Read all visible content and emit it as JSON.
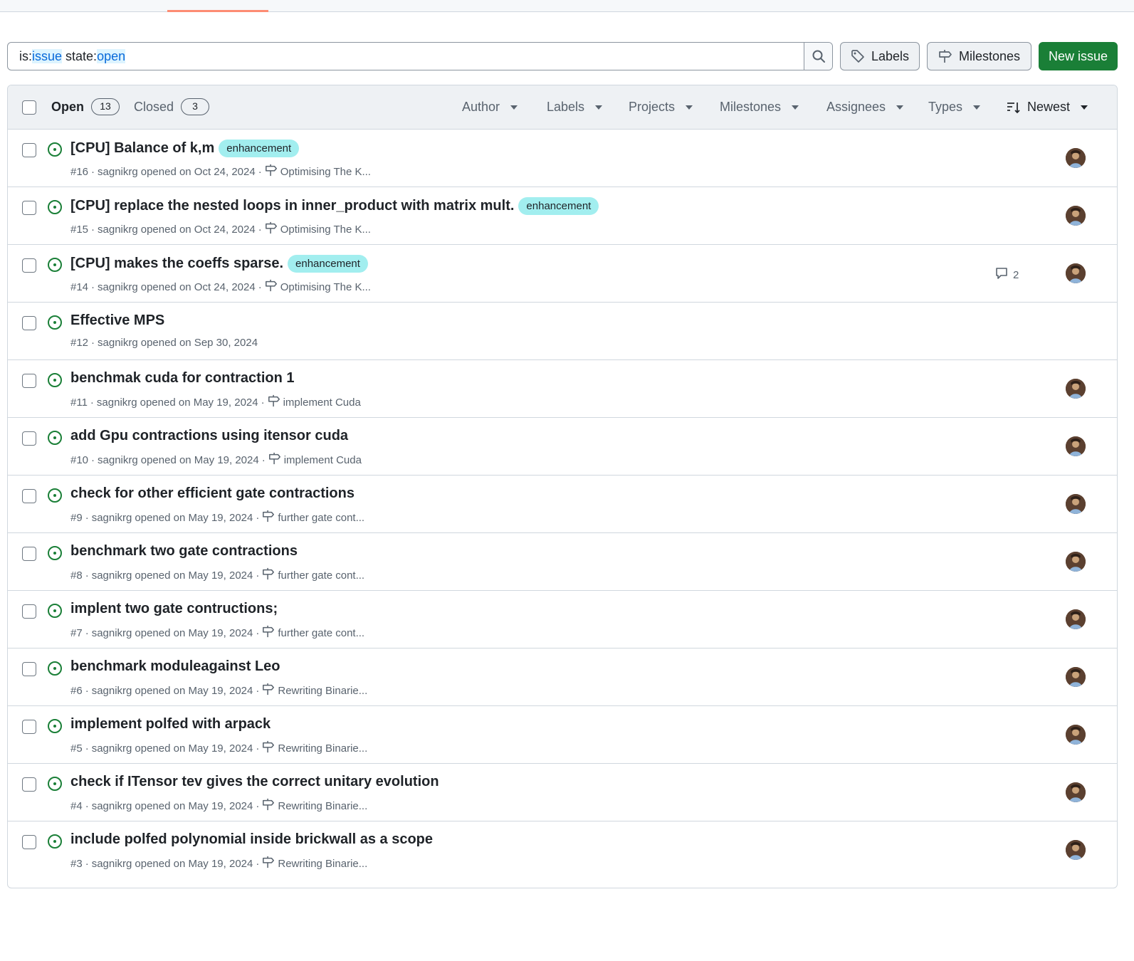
{
  "search": {
    "query_prefix": "is:",
    "query_type": "issue",
    "query_mid": " state:",
    "query_state": "open"
  },
  "toolbar": {
    "labels_button": "Labels",
    "milestones_button": "Milestones",
    "new_issue_button": "New issue"
  },
  "header": {
    "open_label": "Open",
    "open_count": "13",
    "closed_label": "Closed",
    "closed_count": "3",
    "filters": [
      "Author",
      "Labels",
      "Projects",
      "Milestones",
      "Assignees",
      "Types"
    ],
    "sort_label": "Newest"
  },
  "issues": [
    {
      "title": "[CPU] Balance of k,m",
      "label": "enhancement",
      "number": "#16",
      "author": "sagnikrg",
      "opened": "opened on Oct 24, 2024",
      "milestone": "Optimising The K...",
      "comments": "",
      "avatar": true
    },
    {
      "title": "[CPU] replace the nested loops in inner_product with matrix mult.",
      "label": "enhancement",
      "number": "#15",
      "author": "sagnikrg",
      "opened": "opened on Oct 24, 2024",
      "milestone": "Optimising The K...",
      "comments": "",
      "avatar": true
    },
    {
      "title": "[CPU] makes the coeffs sparse.",
      "label": "enhancement",
      "number": "#14",
      "author": "sagnikrg",
      "opened": "opened on Oct 24, 2024",
      "milestone": "Optimising The K...",
      "comments": "2",
      "avatar": true
    },
    {
      "title": "Effective MPS",
      "label": "",
      "number": "#12",
      "author": "sagnikrg",
      "opened": "opened on Sep 30, 2024",
      "milestone": "",
      "comments": "",
      "avatar": false
    },
    {
      "title": "benchmak cuda for contraction 1",
      "label": "",
      "number": "#11",
      "author": "sagnikrg",
      "opened": "opened on May 19, 2024",
      "milestone": "implement Cuda",
      "comments": "",
      "avatar": true
    },
    {
      "title": "add Gpu contractions using itensor cuda",
      "label": "",
      "number": "#10",
      "author": "sagnikrg",
      "opened": "opened on May 19, 2024",
      "milestone": "implement Cuda",
      "comments": "",
      "avatar": true
    },
    {
      "title": "check for other efficient gate contractions",
      "label": "",
      "number": "#9",
      "author": "sagnikrg",
      "opened": "opened on May 19, 2024",
      "milestone": "further gate cont...",
      "comments": "",
      "avatar": true
    },
    {
      "title": "benchmark two gate contractions",
      "label": "",
      "number": "#8",
      "author": "sagnikrg",
      "opened": "opened on May 19, 2024",
      "milestone": "further gate cont...",
      "comments": "",
      "avatar": true
    },
    {
      "title": "implent two gate contructions;",
      "label": "",
      "number": "#7",
      "author": "sagnikrg",
      "opened": "opened on May 19, 2024",
      "milestone": "further gate cont...",
      "comments": "",
      "avatar": true
    },
    {
      "title": "benchmark moduleagainst Leo",
      "label": "",
      "number": "#6",
      "author": "sagnikrg",
      "opened": "opened on May 19, 2024",
      "milestone": "Rewriting Binarie...",
      "comments": "",
      "avatar": true
    },
    {
      "title": "implement polfed with arpack",
      "label": "",
      "number": "#5",
      "author": "sagnikrg",
      "opened": "opened on May 19, 2024",
      "milestone": "Rewriting Binarie...",
      "comments": "",
      "avatar": true
    },
    {
      "title": "check if ITensor tev gives the correct unitary evolution",
      "label": "",
      "number": "#4",
      "author": "sagnikrg",
      "opened": "opened on May 19, 2024",
      "milestone": "Rewriting Binarie...",
      "comments": "",
      "avatar": true
    },
    {
      "title": "include polfed polynomial inside brickwall as a scope",
      "label": "",
      "number": "#3",
      "author": "sagnikrg",
      "opened": "opened on May 19, 2024",
      "milestone": "Rewriting Binarie...",
      "comments": "",
      "avatar": true
    }
  ],
  "colors": {
    "open_state": "#1a7f37",
    "label_enhancement": "#a2eeef",
    "primary_button": "#1a7f37"
  }
}
